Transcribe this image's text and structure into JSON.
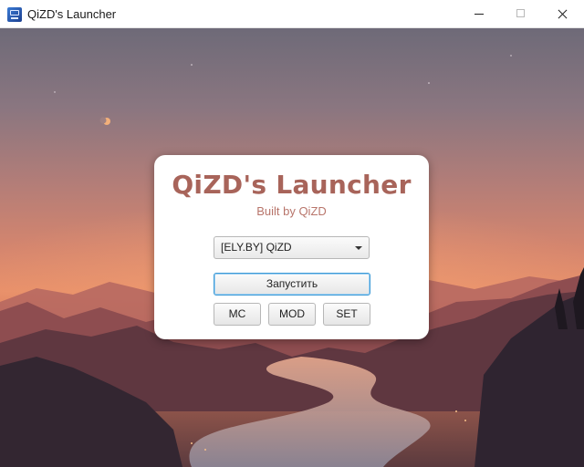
{
  "window": {
    "title": "QiZD's Launcher"
  },
  "card": {
    "title": "QiZD's Launcher",
    "subtitle": "Built by QiZD",
    "profile_select": {
      "value": "[ELY.BY] QiZD"
    },
    "buttons": {
      "launch": "Запустить",
      "mc": "MC",
      "mod": "MOD",
      "set": "SET"
    }
  },
  "colors": {
    "title_accent": "#a8645a",
    "focus_border": "#3d9ad6"
  }
}
